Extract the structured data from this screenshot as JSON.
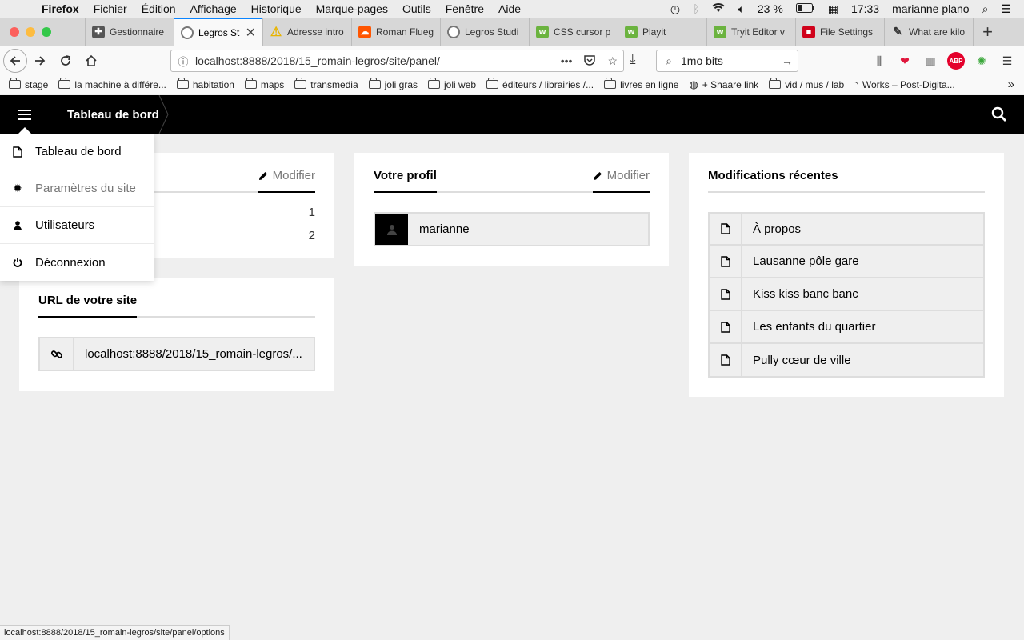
{
  "macos_menubar": {
    "app_name": "Firefox",
    "menus": [
      "Fichier",
      "Édition",
      "Affichage",
      "Historique",
      "Marque-pages",
      "Outils",
      "Fenêtre",
      "Aide"
    ],
    "battery": "23 %",
    "time": "17:33",
    "user": "marianne plano"
  },
  "tabs": [
    {
      "title": "Gestionnaire",
      "icon": "puzzle-icon",
      "color": "#555555"
    },
    {
      "title": "Legros St",
      "icon": "site-icon",
      "color": "#777777",
      "active": true
    },
    {
      "title": "Adresse intro",
      "icon": "warning-icon",
      "color": "#e8b400"
    },
    {
      "title": "Roman Flueg",
      "icon": "soundcloud-icon",
      "color": "#ff5500"
    },
    {
      "title": "Legros Studi",
      "icon": "site-icon",
      "color": "#777777"
    },
    {
      "title": "CSS cursor p",
      "icon": "w3-icon",
      "color": "#6bb33f"
    },
    {
      "title": "Playit",
      "icon": "w3-icon",
      "color": "#6bb33f"
    },
    {
      "title": "Tryit Editor v",
      "icon": "w3-icon",
      "color": "#6bb33f"
    },
    {
      "title": "File Settings",
      "icon": "file-settings-icon",
      "color": "#d0021b"
    },
    {
      "title": "What are kilo",
      "icon": "pen-icon",
      "color": "#333333"
    }
  ],
  "navbar": {
    "url": "localhost:8888/2018/15_romain-legros/site/panel/",
    "search_value": "1mo bits"
  },
  "bookmarks": [
    {
      "label": "stage",
      "icon": "folder-icon"
    },
    {
      "label": "la machine à différe...",
      "icon": "folder-icon"
    },
    {
      "label": "habitation",
      "icon": "folder-icon"
    },
    {
      "label": "maps",
      "icon": "folder-icon"
    },
    {
      "label": "transmedia",
      "icon": "folder-icon"
    },
    {
      "label": "joli gras",
      "icon": "folder-icon"
    },
    {
      "label": "joli web",
      "icon": "folder-icon"
    },
    {
      "label": "éditeurs / librairies /...",
      "icon": "folder-icon"
    },
    {
      "label": "livres en ligne",
      "icon": "folder-icon"
    },
    {
      "label": "+ Shaare link",
      "icon": "globe-icon"
    },
    {
      "label": "vid / mus / lab",
      "icon": "folder-icon"
    },
    {
      "label": "Works – Post-Digita...",
      "icon": "rss-icon"
    }
  ],
  "app": {
    "breadcrumb": "Tableau de bord",
    "menu": [
      {
        "label": "Tableau de bord",
        "icon": "page-icon"
      },
      {
        "label": "Paramètres du site",
        "icon": "gear-icon"
      },
      {
        "label": "Utilisateurs",
        "icon": "user-icon"
      },
      {
        "label": "Déconnexion",
        "icon": "power-icon"
      }
    ],
    "pages_card": {
      "action_label": "Modifier",
      "counts": [
        "1",
        "2"
      ]
    },
    "url_card": {
      "title": "URL de votre site",
      "url": "localhost:8888/2018/15_romain-legros/..."
    },
    "profile_card": {
      "title": "Votre profil",
      "action_label": "Modifier",
      "username": "marianne"
    },
    "recent_card": {
      "title": "Modifications récentes",
      "items": [
        "À propos",
        "Lausanne pôle gare",
        "Kiss kiss banc banc",
        "Les enfants du quartier",
        "Pully cœur de ville"
      ]
    }
  },
  "status_bar": "localhost:8888/2018/15_romain-legros/site/panel/options"
}
